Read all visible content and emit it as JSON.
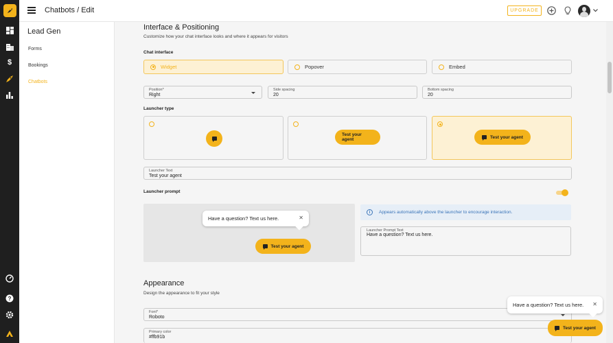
{
  "topbar": {
    "breadcrumb": "Chatbots / Edit",
    "upgrade_label": "UPGRADE"
  },
  "colors": {
    "accent": "#f3b31b",
    "info": "#3a74b8"
  },
  "rail": {
    "icons": [
      "logo-rocket-icon",
      "dashboard-icon",
      "buildings-icon",
      "dollar-icon",
      "rocket-icon",
      "bar-chart-icon",
      "speedometer-icon",
      "help-icon",
      "settings-icon",
      "brand-icon"
    ]
  },
  "subnav": {
    "title": "Lead Gen",
    "items": [
      {
        "label": "Forms"
      },
      {
        "label": "Bookings"
      },
      {
        "label": "Chatbots"
      }
    ]
  },
  "interface": {
    "heading": "Interface & Positioning",
    "subtitle": "Customize how your chat interface looks and where it appears for visitors",
    "chat_interface_label": "Chat interface",
    "options": [
      {
        "label": "Widget",
        "selected": true
      },
      {
        "label": "Popover",
        "selected": false
      },
      {
        "label": "Embed",
        "selected": false
      }
    ],
    "position": {
      "label": "Position*",
      "value": "Right"
    },
    "side_spacing": {
      "label": "Side spacing",
      "value": "20"
    },
    "bottom_spacing": {
      "label": "Bottom spacing",
      "value": "20"
    },
    "launcher_type_label": "Launcher type",
    "launcher_button_text": "Test your agent",
    "launcher_text": {
      "label": "Launcher Text",
      "value": "Test your agent"
    },
    "launcher_prompt_label": "Launcher prompt",
    "launcher_prompt_enabled": true,
    "preview_prompt": "Have a question? Text us here.",
    "preview_button": "Test your agent",
    "info_text": "Appears automatically above the launcher to encourage interaction.",
    "prompt_text": {
      "label": "Launcher Prompt Text",
      "value": "Have a question? Text us here."
    }
  },
  "appearance": {
    "heading": "Appearance",
    "subtitle": "Design the appearance to fit your style",
    "font": {
      "label": "Font*",
      "value": "Roboto"
    },
    "primary_color": {
      "label": "Primary color",
      "value": "#ffb91b"
    }
  },
  "widget": {
    "prompt": "Have a question? Text us here.",
    "button": "Test your agent"
  }
}
